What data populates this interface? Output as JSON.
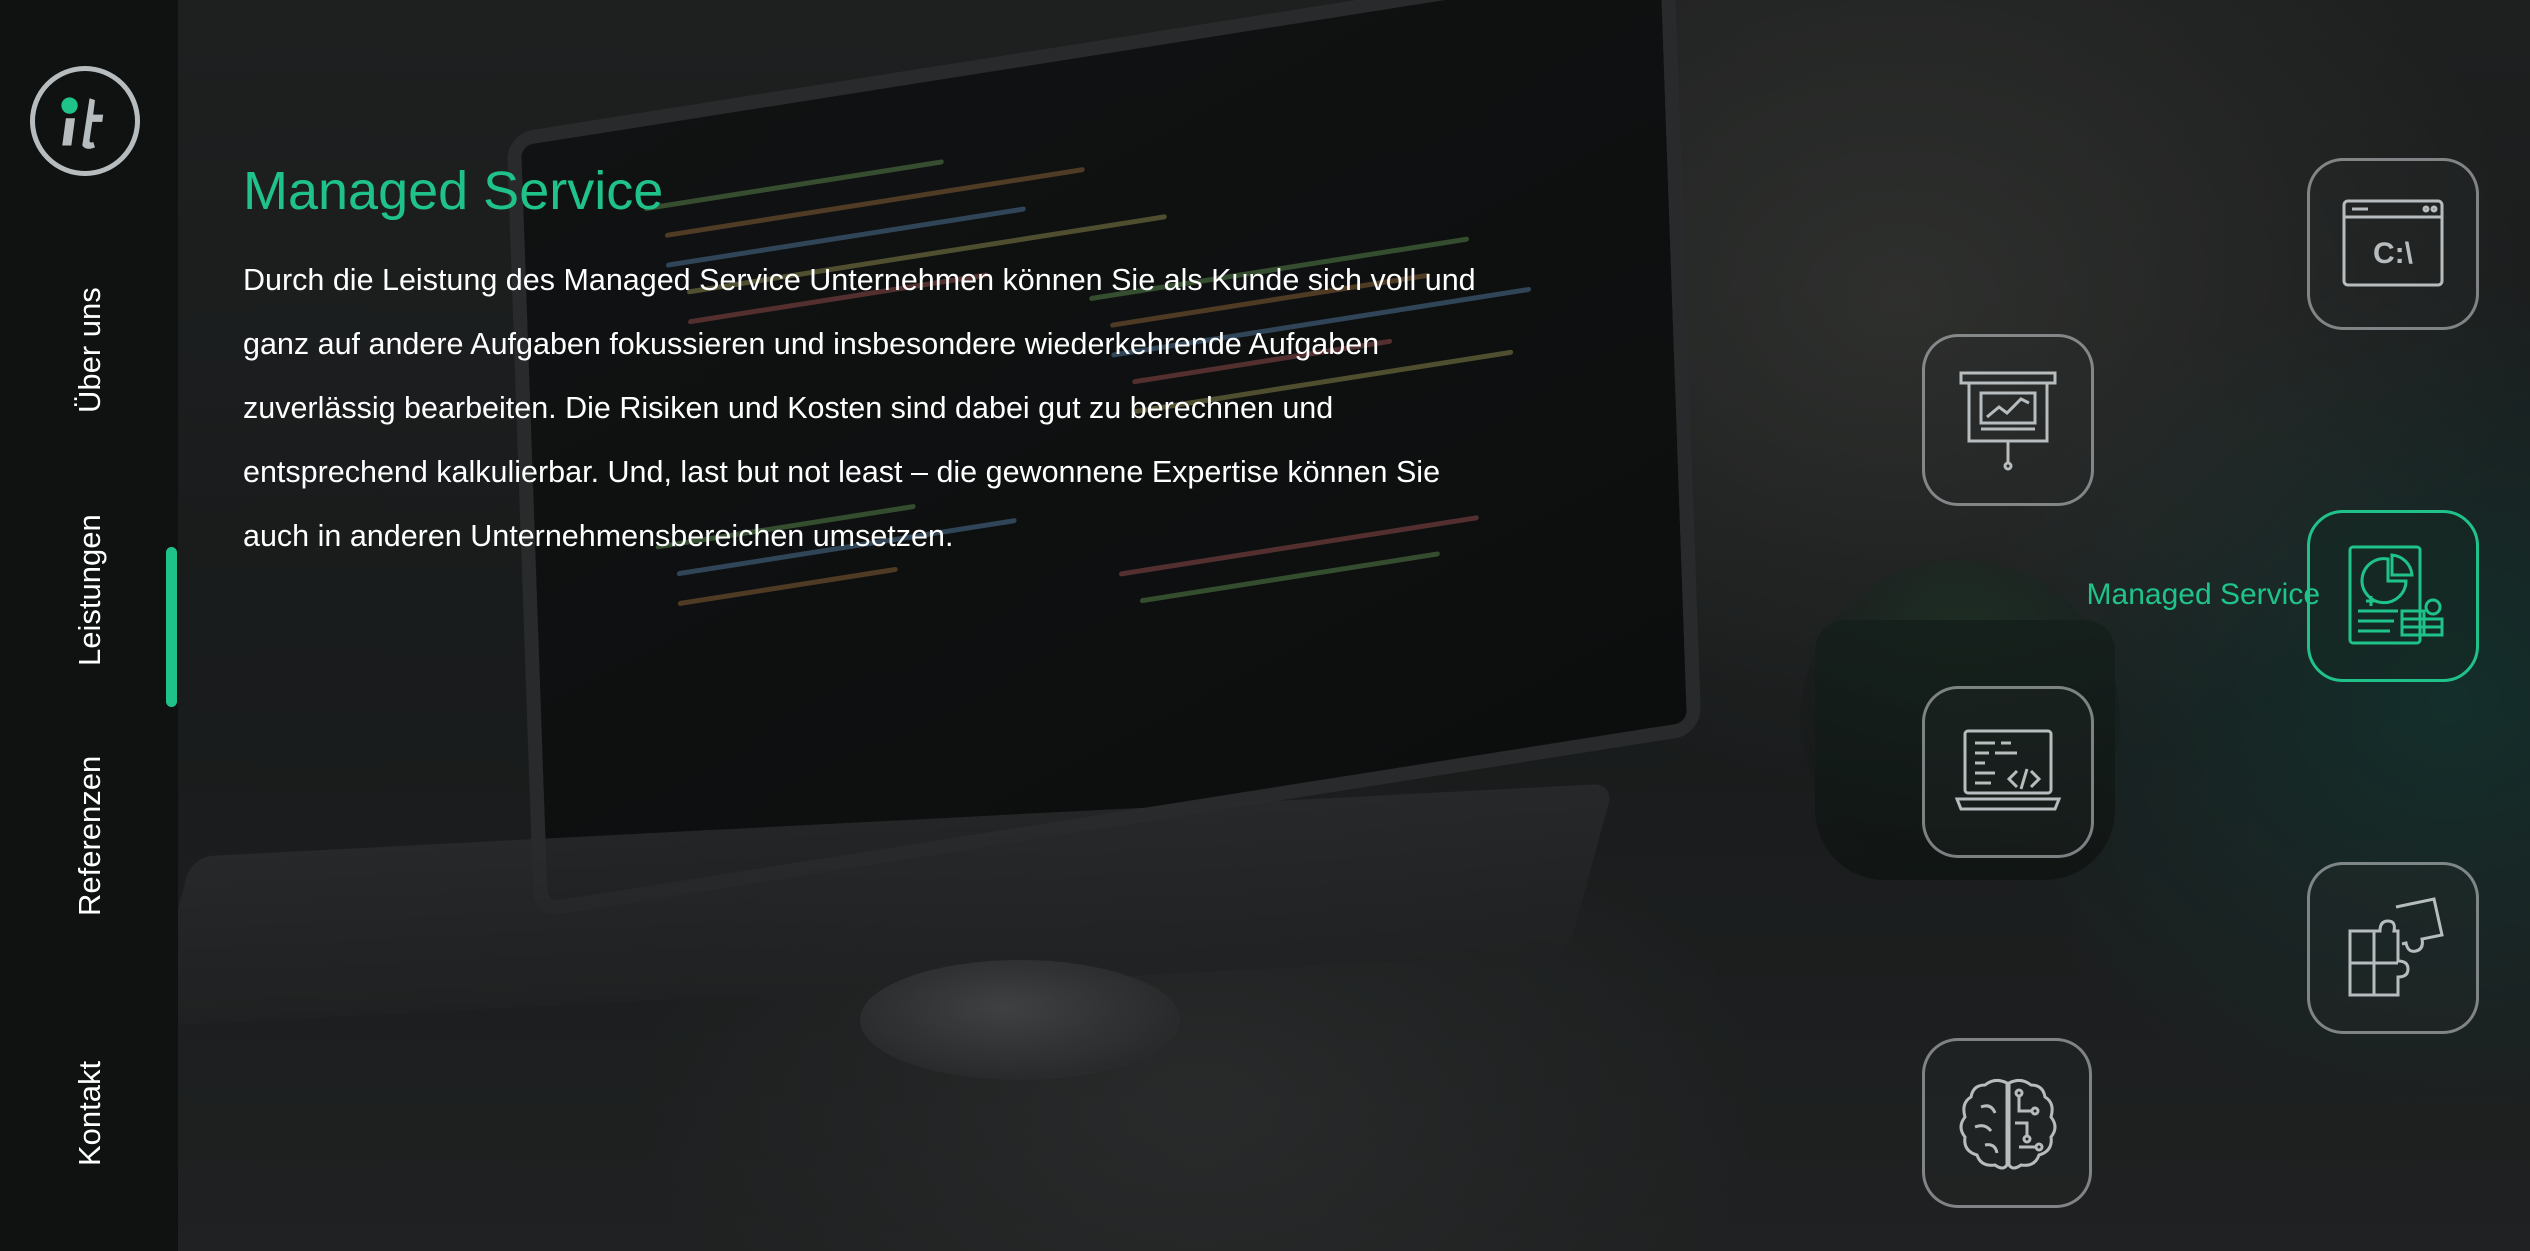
{
  "brand": {
    "logo_text": "it"
  },
  "nav": {
    "items": [
      {
        "label": "Über uns"
      },
      {
        "label": "Leistungen",
        "active": true
      },
      {
        "label": "Referenzen"
      },
      {
        "label": "Kontakt"
      }
    ]
  },
  "main": {
    "title": "Managed Service",
    "paragraph_lines": [
      "Durch die Leistung des Managed Service Unternehmen können Sie als Kunde sich voll und",
      "ganz auf andere Aufgaben fokussieren und insbesondere wiederkehrende Aufgaben",
      "zuverlässig bearbeiten. Die Risiken und Kosten sind dabei gut zu berechnen und",
      "entsprechend kalkulierbar. Und, last but not least – die gewonnene Expertise können Sie",
      "auch in anderen Unternehmensbereichen umsetzen."
    ]
  },
  "services": {
    "active_label": "Managed Service",
    "tiles": [
      {
        "icon": "command-prompt-icon",
        "glyph": "C:\\"
      },
      {
        "icon": "presentation-board-icon"
      },
      {
        "icon": "managed-service-report-icon",
        "active": true
      },
      {
        "icon": "code-laptop-icon"
      },
      {
        "icon": "puzzle-icon"
      },
      {
        "icon": "brain-circuit-icon"
      }
    ]
  },
  "colors": {
    "accent": "#1fc38a",
    "sidebar": "#101212",
    "tile_border": "#d2d6d8"
  }
}
